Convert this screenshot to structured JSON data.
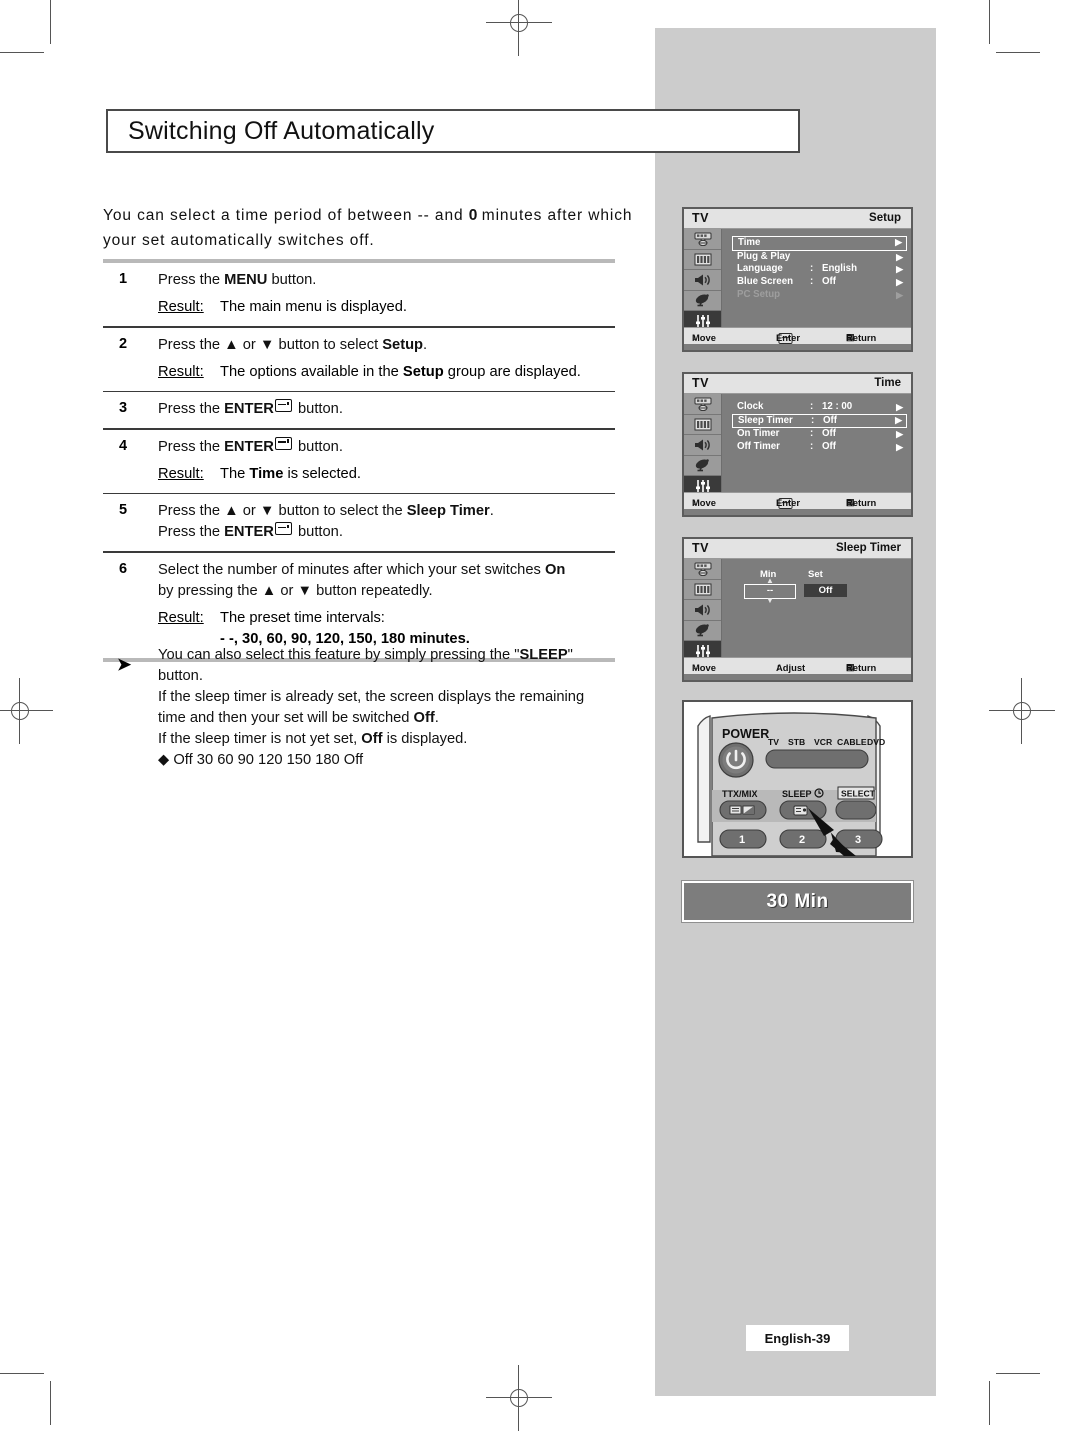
{
  "document": {
    "title": "Switching Off Automatically",
    "intro_line1": "You can select a time period of between -- and 0 minutes after which",
    "intro_line2": "your set automatically switches off.",
    "page_label": "English-39"
  },
  "steps": [
    {
      "number": "1",
      "text_pre": "Press the ",
      "text_bold": "MENU",
      "text_post": " button.",
      "result_label": "Result:",
      "result_pre": "The main menu is displayed.",
      "result_bold": "",
      "result_post": ""
    },
    {
      "number": "2",
      "text_pre": "Press the ",
      "text_bold": "Setup",
      "text_post": ".",
      "text_mid": " or ",
      "text_mid2": " button to select ",
      "result_label": "Result:",
      "result_pre": "The options available in the ",
      "result_bold": "Setup",
      "result_post": " group are displayed."
    },
    {
      "number": "3",
      "text_pre": "Press the ",
      "text_bold": "ENTER",
      "text_post": " button."
    },
    {
      "number": "4",
      "text_pre": "Press the ",
      "text_bold": "ENTER",
      "text_post": " button.",
      "result_label": "Result:",
      "result_pre": "The ",
      "result_bold": "Time",
      "result_post": " is selected."
    },
    {
      "number": "5",
      "line1_pre": "Press the ",
      "line1_mid": " or ",
      "line1_mid2": " button to select the ",
      "line1_bold": "Sleep Timer",
      "line1_post": ".",
      "line2_pre": "Press the ",
      "line2_bold": "ENTER",
      "line2_post": " button."
    },
    {
      "number": "6",
      "line1_pre": "Select the number of minutes after which your set switches ",
      "line1_bold": "On",
      "line2_pre": "by pressing the ",
      "line2_mid": " or ",
      "line2_post": " button repeatedly.",
      "result_label": "Result:",
      "result_line1": "The preset time intervals:",
      "result_line2": "- -,  30,  60,  90,  120,  150,  180 minutes."
    }
  ],
  "note": {
    "arrow_glyph": "➤",
    "line1_pre": "You can also select this feature by simply pressing the \"",
    "line1_bold": "SLEEP",
    "line1_post": "\"",
    "line2": "button.",
    "line3": "If the sleep timer is already set, the screen displays the remaining",
    "line4_pre": "time and then your set will be switched ",
    "line4_bold": "Off",
    "line4_post": ".",
    "line5_pre": "If the sleep timer is not yet set, ",
    "line5_bold": "Off",
    "line5_post": " is displayed.",
    "cycle": "◆ Off  30  60  90  120  150  180  Off"
  },
  "osd_common": {
    "tv_label": "TV",
    "foot_move": "Move",
    "foot_enter": "Enter",
    "foot_return": "Return",
    "foot_adjust": "Adjust",
    "arrow_glyph": "▶",
    "move_glyph": "↕",
    "move_lr_glyph": "↔",
    "colon": ":",
    "rail_icons": [
      "picture-icon",
      "bars-icon",
      "speaker-icon",
      "satellite-dish-icon",
      "sliders-icon"
    ]
  },
  "osd_setup": {
    "header": "Setup",
    "rows": [
      {
        "label": "Time",
        "value": "",
        "selected": true,
        "dim": false,
        "has_value": false
      },
      {
        "label": "Plug & Play",
        "value": "",
        "selected": false,
        "dim": false,
        "has_value": false
      },
      {
        "label": "Language",
        "value": "English",
        "selected": false,
        "dim": false,
        "has_value": true
      },
      {
        "label": "Blue Screen",
        "value": "Off",
        "selected": false,
        "dim": false,
        "has_value": true
      },
      {
        "label": "PC Setup",
        "value": "",
        "selected": false,
        "dim": true,
        "has_value": false
      }
    ]
  },
  "osd_time": {
    "header": "Time",
    "rows": [
      {
        "label": "Clock",
        "value": "12 : 00",
        "selected": false,
        "dim": false,
        "has_value": true
      },
      {
        "label": "Sleep Timer",
        "value": "Off",
        "selected": true,
        "dim": false,
        "has_value": true
      },
      {
        "label": "On Timer",
        "value": "Off",
        "selected": false,
        "dim": false,
        "has_value": true
      },
      {
        "label": "Off Timer",
        "value": "Off",
        "selected": false,
        "dim": false,
        "has_value": true
      }
    ]
  },
  "osd_sleep": {
    "header": "Sleep Timer",
    "min_label": "Min",
    "set_label": "Set",
    "min_value": "--",
    "set_value": "Off"
  },
  "remote": {
    "power_label": "POWER",
    "mode_labels": [
      "TV",
      "STB",
      "VCR",
      "CABLE",
      "DVD"
    ],
    "ttx_label": "TTX/MIX",
    "sleep_label": "SLEEP",
    "select_label": "SELECT",
    "number_buttons": [
      "1",
      "2",
      "3"
    ]
  },
  "banner": {
    "text": "30 Min"
  },
  "colors": {
    "panel_grey": "#cccccc",
    "osd_body": "#7d7d7d",
    "osd_header": "#e3e3e3",
    "osd_rail": "#9b9b9b",
    "osd_rail_active": "#3a3a3a",
    "rule_grey": "#b9b9b9",
    "rule_dark": "#3a3a3a"
  }
}
